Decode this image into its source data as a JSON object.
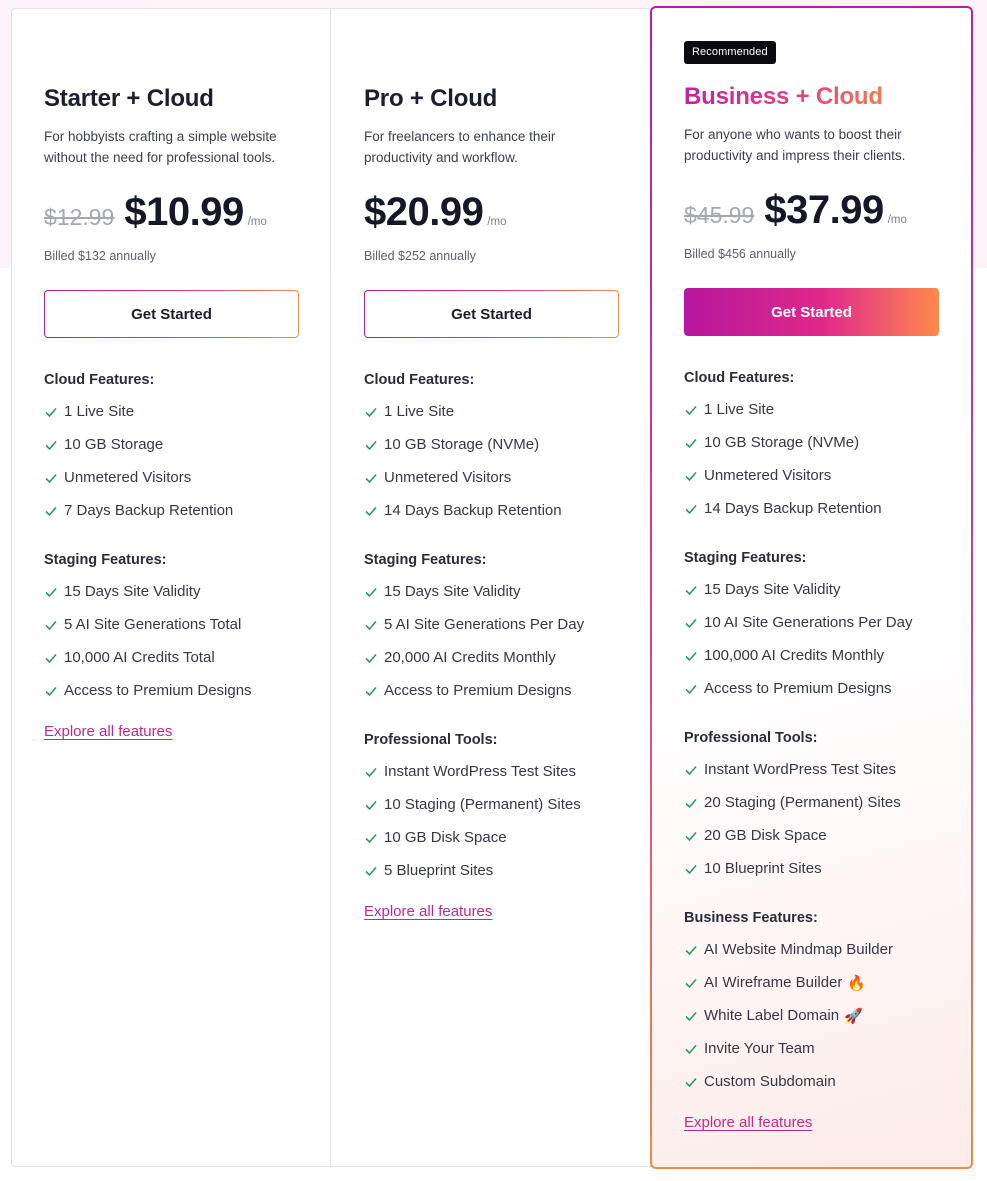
{
  "plans": [
    {
      "title": "Starter + Cloud",
      "description": "For hobbyists crafting a simple website without the need for professional tools.",
      "old_price": "$12.99",
      "price": "$10.99",
      "per": "/mo",
      "billed": "Billed $132 annually",
      "cta": "Get Started",
      "sections": [
        {
          "heading": "Cloud Features:",
          "items": [
            "1 Live Site",
            "10 GB Storage",
            "Unmetered Visitors",
            "7 Days Backup Retention"
          ]
        },
        {
          "heading": "Staging Features:",
          "items": [
            "15 Days Site Validity",
            "5 AI Site Generations Total",
            "10,000 AI Credits Total",
            "Access to Premium Designs"
          ]
        }
      ],
      "explore": "Explore all features"
    },
    {
      "title": "Pro + Cloud",
      "description": "For freelancers to enhance their productivity and workflow.",
      "price": "$20.99",
      "per": "/mo",
      "billed": "Billed $252 annually",
      "cta": "Get Started",
      "sections": [
        {
          "heading": "Cloud Features:",
          "items": [
            "1 Live Site",
            "10 GB Storage (NVMe)",
            "Unmetered Visitors",
            "14 Days Backup Retention"
          ]
        },
        {
          "heading": "Staging Features:",
          "items": [
            "15 Days Site Validity",
            "5 AI Site Generations Per Day",
            "20,000 AI Credits Monthly",
            "Access to Premium Designs"
          ]
        },
        {
          "heading": "Professional Tools:",
          "items": [
            "Instant WordPress Test Sites",
            "10 Staging (Permanent) Sites",
            "10 GB Disk Space",
            "5 Blueprint Sites"
          ]
        }
      ],
      "explore": "Explore all features"
    },
    {
      "badge": "Recommended",
      "title": "Business + Cloud",
      "description": "For anyone who wants to boost their productivity and impress their clients.",
      "old_price": "$45.99",
      "price": "$37.99",
      "per": "/mo",
      "billed": "Billed $456 annually",
      "cta": "Get Started",
      "sections": [
        {
          "heading": "Cloud Features:",
          "items": [
            "1 Live Site",
            "10 GB Storage (NVMe)",
            "Unmetered Visitors",
            "14 Days Backup Retention"
          ]
        },
        {
          "heading": "Staging Features:",
          "items": [
            "15 Days Site Validity",
            "10 AI Site Generations Per Day",
            "100,000 AI Credits Monthly",
            "Access to Premium Designs"
          ]
        },
        {
          "heading": "Professional Tools:",
          "items": [
            "Instant WordPress Test Sites",
            "20 Staging (Permanent) Sites",
            "20 GB Disk Space",
            "10 Blueprint Sites"
          ]
        },
        {
          "heading": "Business Features:",
          "items": [
            "AI Website Mindmap Builder",
            "AI Wireframe Builder",
            "White Label Domain",
            "Invite Your Team",
            "Custom Subdomain"
          ]
        }
      ],
      "emojis": {
        "ai_wireframe": "🔥",
        "white_label": "🚀"
      },
      "explore": "Explore all features"
    }
  ],
  "colors": {
    "accent_link": "#c2288e",
    "check": "#2e9b5e",
    "gradient_start": "#b5179e",
    "gradient_end": "#ff8a4c",
    "badge_bg": "#0b0b0f"
  },
  "icons": {
    "feature_bullet": "check-icon"
  }
}
